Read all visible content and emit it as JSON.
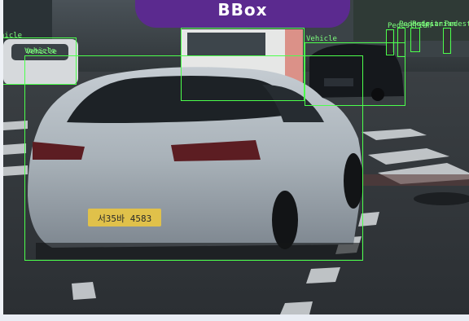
{
  "header": {
    "badge_label": "BBox",
    "badge_color": "#5b2a8f"
  },
  "scene": {
    "description_icon": "car-photo",
    "plate_text": "서35바 4583",
    "box_color": "#4cff4c"
  },
  "detections": [
    {
      "label": "Vehicle"
    },
    {
      "label": "Vehicle"
    },
    {
      "label": ""
    },
    {
      "label": ""
    },
    {
      "label": "Vehicle"
    },
    {
      "label": "Pedestrian"
    },
    {
      "label": "Pedestrian"
    },
    {
      "label": "Pedestrian"
    },
    {
      "label": "Pedestrian"
    }
  ],
  "edge_label": "hicle"
}
